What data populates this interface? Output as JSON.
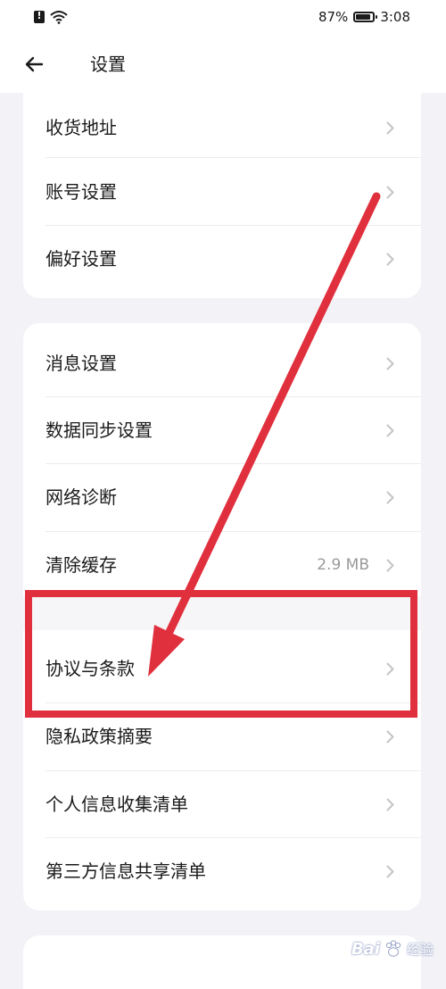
{
  "status_bar": {
    "battery": "87%",
    "time": "3:08",
    "icons": [
      "alert-icon",
      "wifi-icon",
      "battery-icon"
    ]
  },
  "nav": {
    "title": "设置",
    "back_icon": "arrow-left-icon"
  },
  "groups": [
    {
      "items": [
        {
          "label": "收货地址",
          "value": ""
        },
        {
          "label": "账号设置",
          "value": ""
        },
        {
          "label": "偏好设置",
          "value": ""
        }
      ]
    },
    {
      "items": [
        {
          "label": "消息设置",
          "value": ""
        },
        {
          "label": "数据同步设置",
          "value": ""
        },
        {
          "label": "网络诊断",
          "value": ""
        },
        {
          "label": "清除缓存",
          "value": "2.9 MB"
        },
        {
          "label": "协议与条款",
          "value": ""
        },
        {
          "label": "隐私政策摘要",
          "value": ""
        },
        {
          "label": "个人信息收集清单",
          "value": ""
        },
        {
          "label": "第三方信息共享清单",
          "value": ""
        }
      ]
    }
  ],
  "annotation": {
    "color": "#e0303d",
    "highlighted_item": "协议与条款"
  },
  "watermark": {
    "brand": "Bai",
    "sub": "经验"
  },
  "colors": {
    "background": "#f3f3f7",
    "card": "#ffffff",
    "text": "#1a1a1a",
    "secondary_text": "#9a9a9a",
    "chevron": "#c4c4c4"
  }
}
